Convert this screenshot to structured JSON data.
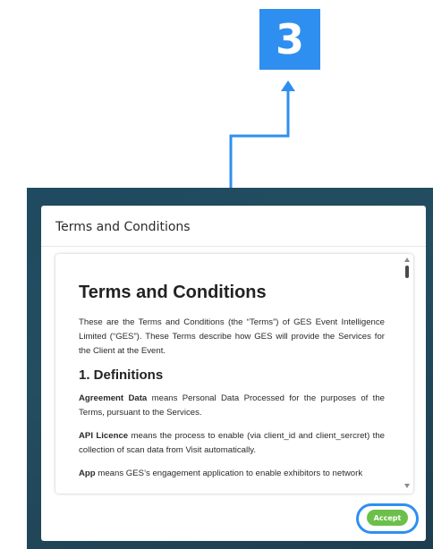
{
  "annotation": {
    "step_number": "3",
    "accent_color": "#2f8ff0"
  },
  "modal": {
    "title": "Terms and Conditions",
    "accept_label": "Accept",
    "accept_color": "#6cc04a"
  },
  "document": {
    "title": "Terms and Conditions",
    "intro": "These are the Terms and Conditions (the “Terms”) of GES Event Intelligence Limited (“GES”). These Terms describe how GES will provide the Services for the Client at the Event.",
    "section_heading": "1. Definitions",
    "definitions": [
      {
        "term": "Agreement Data",
        "text": " means Personal Data Processed for the purposes of the Terms, pursuant to the Services."
      },
      {
        "term": "API Licence",
        "text": " means the process to enable (via client_id and client_sercret) the collection of scan data from Visit automatically."
      },
      {
        "term": "App",
        "text": " means GES’s engagement application to enable exhibitors to network"
      }
    ]
  }
}
